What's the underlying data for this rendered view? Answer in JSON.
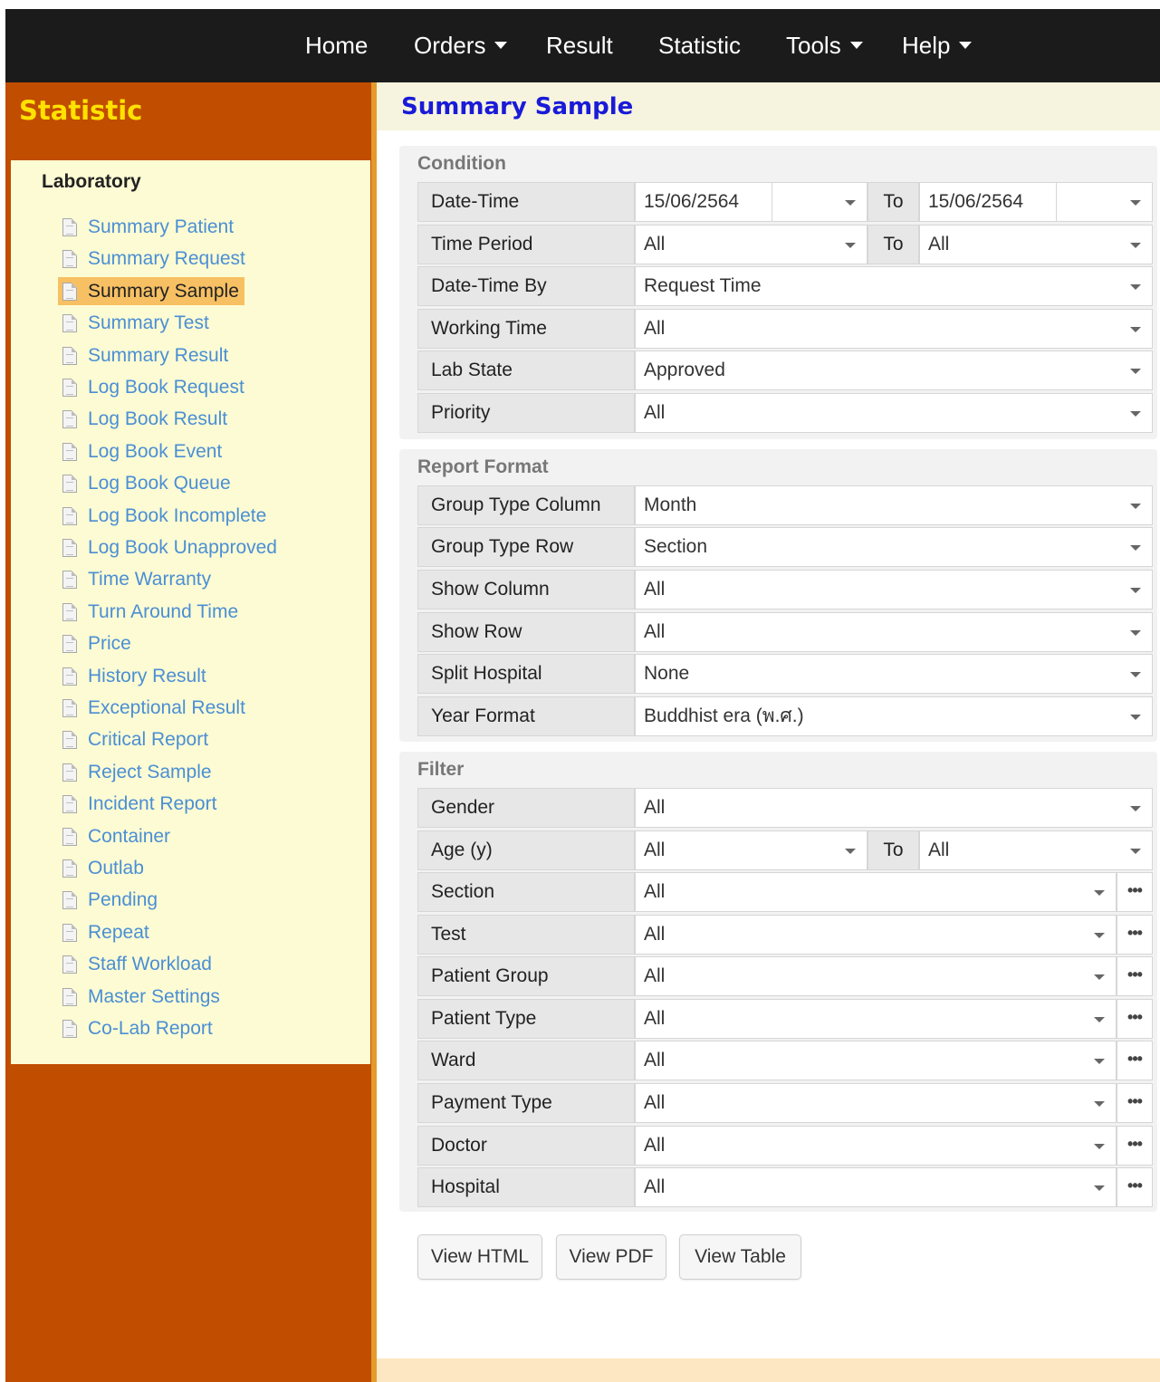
{
  "nav": {
    "home": "Home",
    "orders": "Orders",
    "result": "Result",
    "statistic": "Statistic",
    "tools": "Tools",
    "help": "Help"
  },
  "sidebar": {
    "title": "Statistic",
    "heading": "Laboratory",
    "active_item": "Summary Sample",
    "items": [
      "Summary Patient",
      "Summary Request",
      "Summary Sample",
      "Summary Test",
      "Summary Result",
      "Log Book Request",
      "Log Book Result",
      "Log Book Event",
      "Log Book Queue",
      "Log Book Incomplete",
      "Log Book Unapproved",
      "Time Warranty",
      "Turn Around Time",
      "Price",
      "History Result",
      "Exceptional Result",
      "Critical Report",
      "Reject Sample",
      "Incident Report",
      "Container",
      "Outlab",
      "Pending",
      "Repeat",
      "Staff Workload",
      "Master Settings",
      "Co-Lab Report"
    ]
  },
  "page": {
    "title": "Summary Sample"
  },
  "condition": {
    "title": "Condition",
    "to_label": "To",
    "date_time": {
      "label": "Date-Time",
      "from": "15/06/2564",
      "from_time": "",
      "to": "15/06/2564",
      "to_time": ""
    },
    "time_period": {
      "label": "Time Period",
      "from": "All",
      "to": "All"
    },
    "date_time_by": {
      "label": "Date-Time By",
      "value": "Request Time"
    },
    "working_time": {
      "label": "Working Time",
      "value": "All"
    },
    "lab_state": {
      "label": "Lab State",
      "value": "Approved"
    },
    "priority": {
      "label": "Priority",
      "value": "All"
    }
  },
  "report_format": {
    "title": "Report Format",
    "group_type_column": {
      "label": "Group Type Column",
      "value": "Month"
    },
    "group_type_row": {
      "label": "Group Type Row",
      "value": "Section"
    },
    "show_column": {
      "label": "Show Column",
      "value": "All"
    },
    "show_row": {
      "label": "Show Row",
      "value": "All"
    },
    "split_hospital": {
      "label": "Split Hospital",
      "value": "None"
    },
    "year_format": {
      "label": "Year Format",
      "value": "Buddhist era (พ.ศ.)"
    }
  },
  "filter": {
    "title": "Filter",
    "more_glyph": "•••",
    "gender": {
      "label": "Gender",
      "value": "All"
    },
    "age": {
      "label": "Age (y)",
      "from": "All",
      "to": "All"
    },
    "section": {
      "label": "Section",
      "value": "All"
    },
    "test": {
      "label": "Test",
      "value": "All"
    },
    "patient_group": {
      "label": "Patient Group",
      "value": "All"
    },
    "patient_type": {
      "label": "Patient Type",
      "value": "All"
    },
    "ward": {
      "label": "Ward",
      "value": "All"
    },
    "payment_type": {
      "label": "Payment Type",
      "value": "All"
    },
    "doctor": {
      "label": "Doctor",
      "value": "All"
    },
    "hospital": {
      "label": "Hospital",
      "value": "All"
    }
  },
  "actions": {
    "view_html": "View HTML",
    "view_pdf": "View PDF",
    "view_table": "View Table"
  },
  "colors": {
    "nav_bg": "#1b1b1b",
    "sidebar_bg": "#c14d00",
    "sidebar_title": "#ffe200",
    "sidebar_panel": "#fdfbd3",
    "active_item": "#f7c063",
    "link": "#4a8fd4",
    "page_title": "#1a1ad8"
  }
}
